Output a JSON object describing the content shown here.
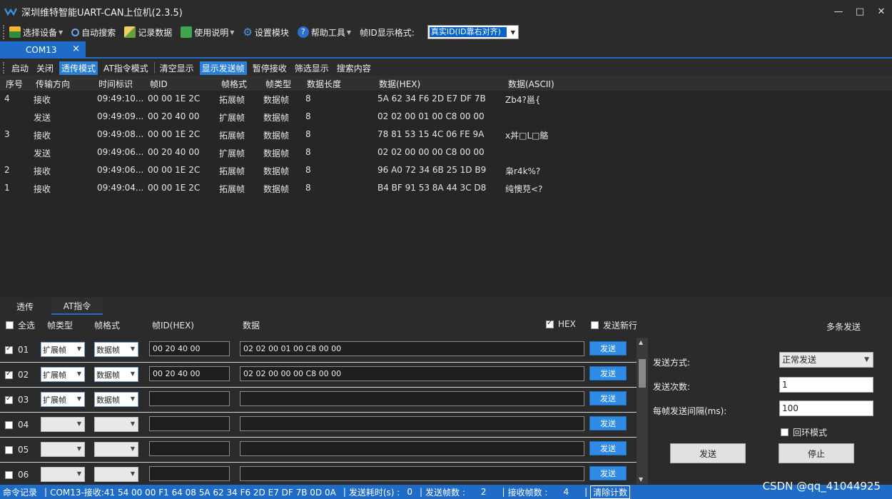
{
  "app": {
    "title": "深圳维特智能UART-CAN上位机(2.3.5)"
  },
  "toolbar": {
    "select_device": "选择设备",
    "auto_search": "自动搜索",
    "record_data": "记录数据",
    "usage": "使用说明",
    "settings": "设置模块",
    "help": "帮助工具",
    "id_format_label": "帧ID显示格式:",
    "id_format_value": "真实ID(ID靠右对齐)"
  },
  "tab": {
    "label": "COM13"
  },
  "commands": {
    "start": "启动",
    "close": "关闭",
    "passthrough": "透传模式",
    "at_mode": "AT指令模式",
    "clear": "清空显示",
    "show_sent": "显示发送帧",
    "pause": "暂停接收",
    "filter": "筛选显示",
    "search": "搜索内容"
  },
  "grid": {
    "headers": [
      "序号",
      "传输方向",
      "时间标识",
      "帧ID",
      "帧格式",
      "帧类型",
      "数据长度",
      "数据(HEX)",
      "数据(ASCII)"
    ],
    "rows": [
      [
        "4",
        "接收",
        "09:49:10...",
        "00 00 1E 2C",
        "拓展帧",
        "数据帧",
        "8",
        "5A 62 34 F6 2D E7 DF 7B",
        "Zb4?邕{"
      ],
      [
        "",
        "发送",
        "09:49:09...",
        "00 20 40 00",
        "扩展帧",
        "数据帧",
        "8",
        "02 02 00 01 00 C8 00 00",
        ""
      ],
      [
        "3",
        "接收",
        "09:49:08...",
        "00 00 1E 2C",
        "拓展帧",
        "数据帧",
        "8",
        "78 81 53 15 4C 06 FE 9A",
        "x丼□L□鴼"
      ],
      [
        "",
        "发送",
        "09:49:06...",
        "00 20 40 00",
        "扩展帧",
        "数据帧",
        "8",
        "02 02 00 00 00 C8 00 00",
        ""
      ],
      [
        "2",
        "接收",
        "09:49:06...",
        "00 00 1E 2C",
        "拓展帧",
        "数据帧",
        "8",
        "96 A0 72 34 6B 25 1D B9",
        "枭r4k%?"
      ],
      [
        "1",
        "接收",
        "09:49:04...",
        "00 00 1E 2C",
        "拓展帧",
        "数据帧",
        "8",
        "B4 BF 91 53 8A 44 3C D8",
        "纯懊萖<?"
      ]
    ]
  },
  "bottom_tabs": {
    "pass": "透传",
    "at": "AT指令"
  },
  "at_header": {
    "select_all": "全选",
    "frame_type": "帧类型",
    "frame_format": "帧格式",
    "frame_id": "帧ID(HEX)",
    "data": "数据",
    "hex": "HEX",
    "newline": "发送新行",
    "multi": "多条发送"
  },
  "at_rows": [
    {
      "num": "01",
      "checked": true,
      "type": "扩展帧",
      "format": "数据帧",
      "id": "00 20 40 00",
      "data": "02 02 00 01 00 C8 00 00",
      "send": "发送"
    },
    {
      "num": "02",
      "checked": true,
      "type": "扩展帧",
      "format": "数据帧",
      "id": "00 20 40 00",
      "data": "02 02 00 00 00 C8 00 00",
      "send": "发送"
    },
    {
      "num": "03",
      "checked": true,
      "type": "扩展帧",
      "format": "数据帧",
      "id": "",
      "data": "",
      "send": "发送"
    },
    {
      "num": "04",
      "checked": false,
      "type": "",
      "format": "",
      "id": "",
      "data": "",
      "send": "发送"
    },
    {
      "num": "05",
      "checked": false,
      "type": "",
      "format": "",
      "id": "",
      "data": "",
      "send": "发送"
    },
    {
      "num": "06",
      "checked": false,
      "type": "",
      "format": "",
      "id": "",
      "data": "",
      "send": "发送"
    }
  ],
  "multi": {
    "mode_label": "发送方式:",
    "mode_value": "正常发送",
    "count_label": "发送次数:",
    "count_value": "1",
    "interval_label": "每帧发送间隔(ms):",
    "interval_value": "100",
    "loop_label": "回环模式",
    "send": "发送",
    "stop": "停止"
  },
  "status": {
    "cmd_log": "命令记录",
    "last_rx": "COM13-接收:41 54 00 00 F1 64 08 5A 62 34 F6 2D E7 DF 7B 0D 0A",
    "elapsed_label": "发送耗时(s) :",
    "elapsed_value": "0",
    "tx_label": "发送帧数 :",
    "tx_value": "2",
    "rx_label": "接收帧数 :",
    "rx_value": "4",
    "clear": "清除计数",
    "watermark": "CSDN @qq_41044925"
  }
}
